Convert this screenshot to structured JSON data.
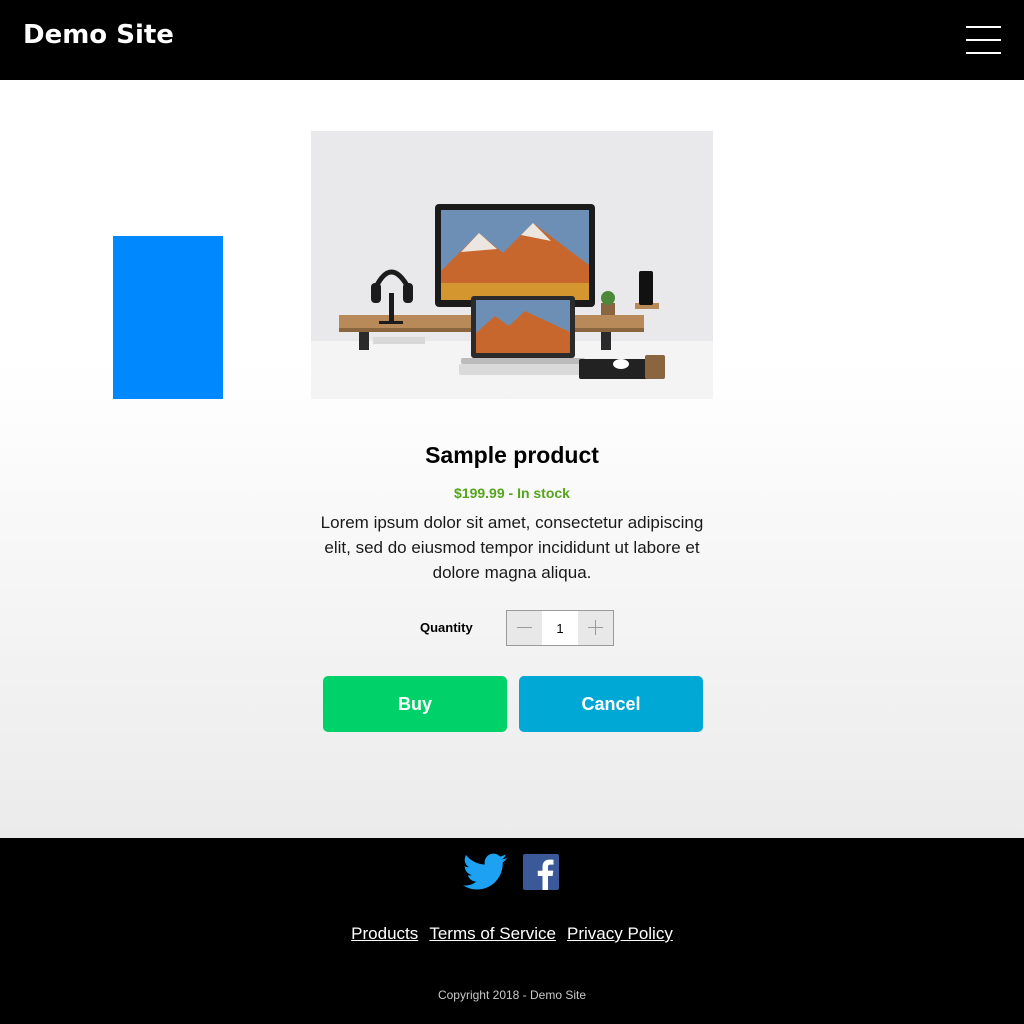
{
  "header": {
    "site_title": "Demo Site",
    "menu_icon": "hamburger-menu-icon"
  },
  "main": {
    "image_alt": "Desk with monitor, laptop and headphones",
    "product": {
      "title": "Sample product",
      "price_status": "$199.99 - In stock",
      "description": "Lorem ipsum dolor sit amet, consectetur adipiscing elit, sed do eiusmod tempor incididunt ut labore et dolore magna aliqua."
    },
    "quantity": {
      "label": "Quantity",
      "value": "1"
    },
    "buttons": {
      "buy": "Buy",
      "cancel": "Cancel"
    }
  },
  "footer": {
    "social": [
      "twitter-icon",
      "facebook-icon"
    ],
    "links": [
      "Products",
      "Terms of Service",
      "Privacy Policy"
    ],
    "copyright": "Copyright 2018 - Demo Site"
  },
  "colors": {
    "header_bg": "#000000",
    "accent_blue_box": "#0088ff",
    "price_green": "#56a51e",
    "buy_green": "#00d26a",
    "cancel_blue": "#00a8d6",
    "twitter_blue": "#1da1f2",
    "facebook_blue": "#3b5998"
  }
}
